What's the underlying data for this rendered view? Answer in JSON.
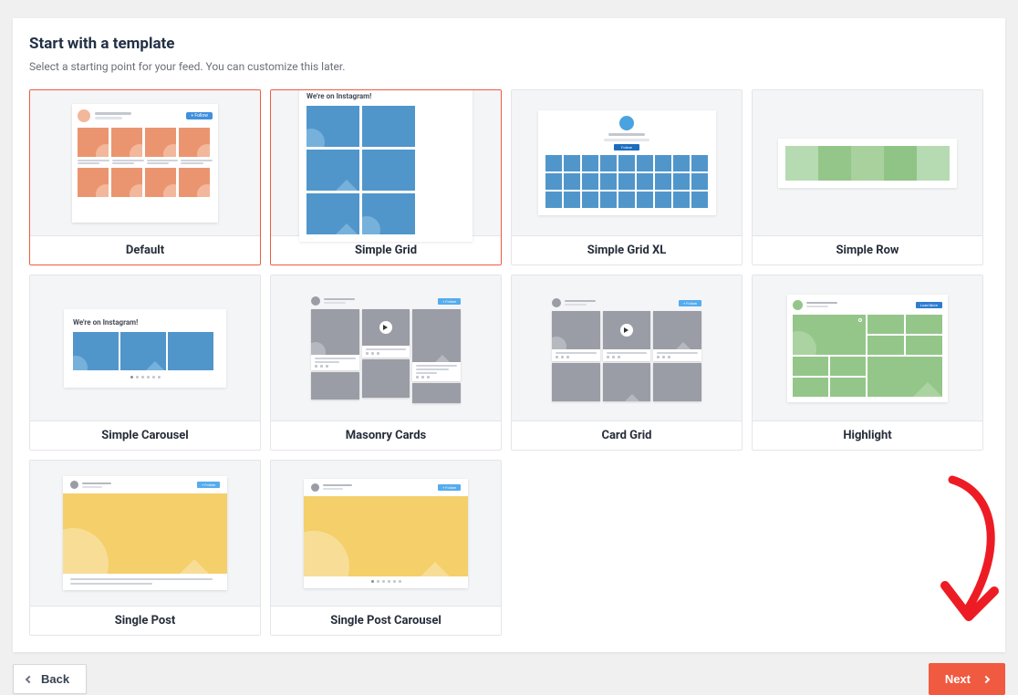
{
  "header": {
    "title": "Start with a template",
    "subtitle": "Select a starting point for your feed. You can customize this later."
  },
  "preview_text": {
    "instagram_banner": "We're on Instagram!",
    "follow": "+ Follow",
    "follow_alt": "Follow",
    "load_more": "Load More"
  },
  "templates": [
    {
      "id": "default",
      "label": "Default",
      "selected": true
    },
    {
      "id": "simple-grid",
      "label": "Simple Grid",
      "selected": false
    },
    {
      "id": "simple-grid-xl",
      "label": "Simple Grid XL",
      "selected": false
    },
    {
      "id": "simple-row",
      "label": "Simple Row",
      "selected": false
    },
    {
      "id": "simple-carousel",
      "label": "Simple Carousel",
      "selected": false
    },
    {
      "id": "masonry-cards",
      "label": "Masonry Cards",
      "selected": false
    },
    {
      "id": "card-grid",
      "label": "Card Grid",
      "selected": false
    },
    {
      "id": "highlight",
      "label": "Highlight",
      "selected": false
    },
    {
      "id": "single-post",
      "label": "Single Post",
      "selected": false
    },
    {
      "id": "single-post-carousel",
      "label": "Single Post Carousel",
      "selected": false
    }
  ],
  "footer": {
    "back": "Back",
    "next": "Next"
  },
  "colors": {
    "accent": "#f05a40",
    "blue": "#5196cb",
    "orange": "#eb9570",
    "green": "#94c68a",
    "yellow": "#f4cf6a"
  },
  "annotation": {
    "type": "hand-drawn-arrow",
    "target": "next-button",
    "color": "#ed1c24"
  }
}
